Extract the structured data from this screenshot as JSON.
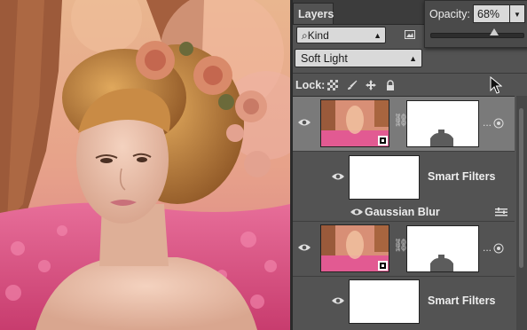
{
  "panel": {
    "tab_title": "Layers",
    "collapse_glyph": "«",
    "filter": {
      "kind_label": "Kind",
      "search_glyph": "⌕"
    },
    "blend_mode": "Soft Light",
    "opacity": {
      "label": "Opacity:",
      "value": "68%",
      "level": 0.68
    },
    "lock_label": "Lock:",
    "layers": [
      {
        "type": "smart-object",
        "selected": true,
        "mask_dots": "..."
      },
      {
        "type": "smart-filters",
        "label": "Smart Filters"
      },
      {
        "type": "filter-item",
        "label": "Gaussian Blur"
      },
      {
        "type": "smart-object",
        "selected": false,
        "mask_dots": "..."
      },
      {
        "type": "smart-filters",
        "label": "Smart Filters"
      }
    ]
  },
  "icons": {
    "filter": [
      "image-filter-icon",
      "adjustment-filter-icon",
      "type-filter-icon",
      "shape-filter-icon",
      "smart-object-filter-icon"
    ],
    "lock": [
      "lock-transparent-pixels-icon",
      "lock-image-pixels-icon",
      "lock-position-icon",
      "lock-all-icon"
    ]
  },
  "colors": {
    "panel_bg": "#535353",
    "selected_row": "#7a7a7a",
    "field_bg": "#d9d9d9"
  }
}
